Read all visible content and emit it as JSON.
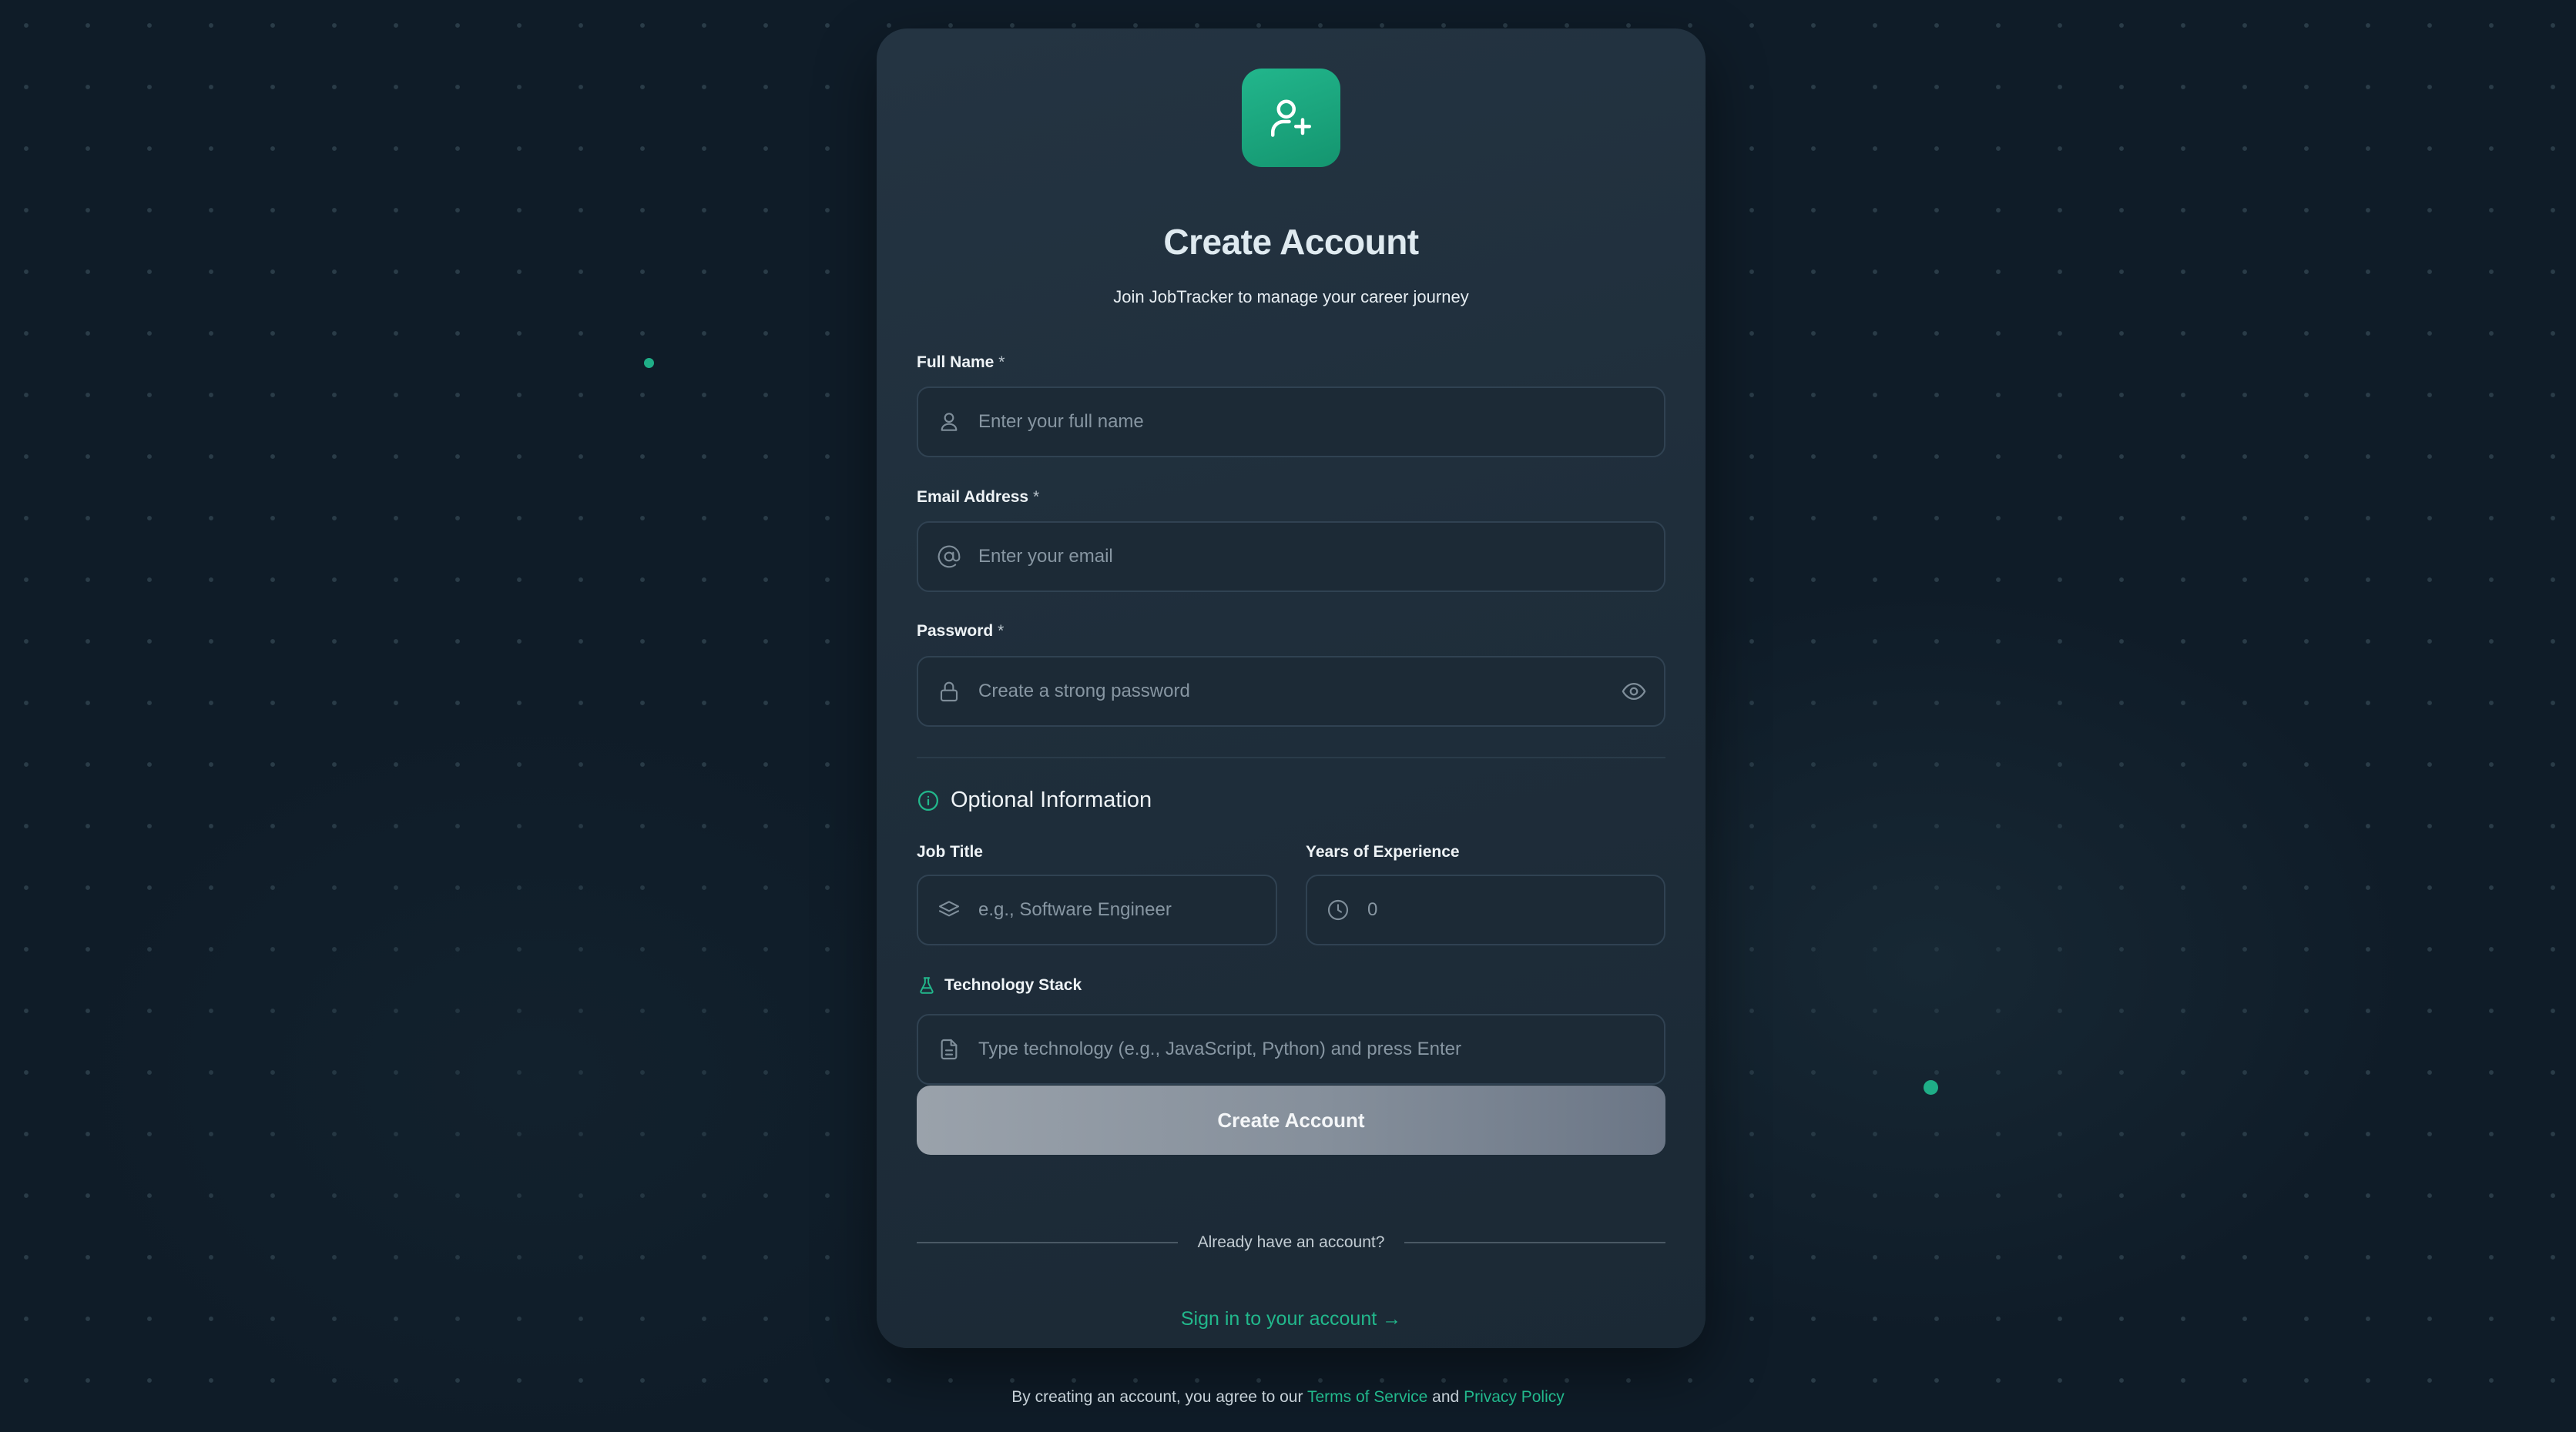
{
  "header": {
    "title": "Create Account",
    "subtitle": "Join JobTracker to manage your career journey",
    "logo_icon": "user-plus-icon"
  },
  "form": {
    "full_name": {
      "label": "Full Name",
      "required_mark": "*",
      "placeholder": "Enter your full name",
      "icon": "user-icon"
    },
    "email": {
      "label": "Email Address",
      "required_mark": "*",
      "placeholder": "Enter your email",
      "icon": "at-sign-icon"
    },
    "password": {
      "label": "Password",
      "required_mark": "*",
      "placeholder": "Create a strong password",
      "icon": "lock-icon",
      "toggle_icon": "eye-icon"
    }
  },
  "optional": {
    "heading": "Optional Information",
    "heading_icon": "info-icon",
    "job_title": {
      "label": "Job Title",
      "placeholder": "e.g., Software Engineer",
      "icon": "layers-icon"
    },
    "experience": {
      "label": "Years of Experience",
      "placeholder": "0",
      "icon": "clock-icon"
    },
    "tech_stack": {
      "label": "Technology Stack",
      "label_icon": "flask-icon",
      "placeholder": "Type technology (e.g., JavaScript, Python) and press Enter",
      "icon": "document-icon"
    }
  },
  "actions": {
    "submit_label": "Create Account",
    "divider_text": "Already have an account?",
    "signin_label": "Sign in to your account →"
  },
  "footer": {
    "prefix": "By creating an account, you agree to our",
    "terms": "Terms of Service",
    "and": "and",
    "privacy": "Privacy Policy"
  },
  "colors": {
    "accent": "#22b88c",
    "background": "#0f1c28",
    "card": "#1f2e3b",
    "button_disabled": "#858f9b"
  }
}
